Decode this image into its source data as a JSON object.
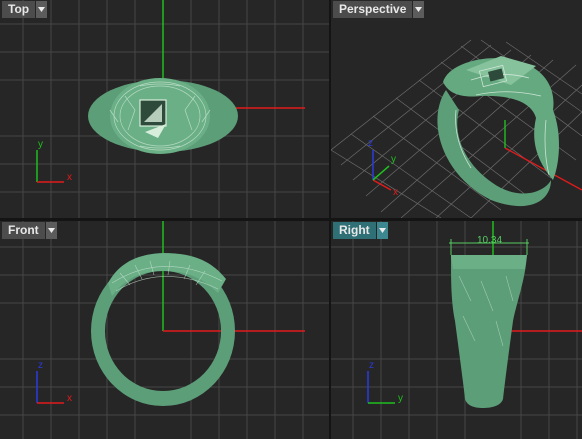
{
  "viewports": {
    "top": {
      "label": "Top"
    },
    "perspective": {
      "label": "Perspective"
    },
    "front": {
      "label": "Front"
    },
    "right": {
      "label": "Right",
      "dimension": "10.34"
    }
  },
  "axis_labels": {
    "x": "x",
    "y": "y",
    "z": "z"
  },
  "colors": {
    "viewport_bg": "#262626",
    "grid": "#4a4a4a",
    "model": "#5c9e78",
    "x_axis": "#e31a1a",
    "y_axis": "#1fbf1f",
    "z_axis": "#2a3bd6",
    "active_label": "#2f6f76"
  },
  "icons": {
    "dropdown": "triangle-down-icon"
  }
}
